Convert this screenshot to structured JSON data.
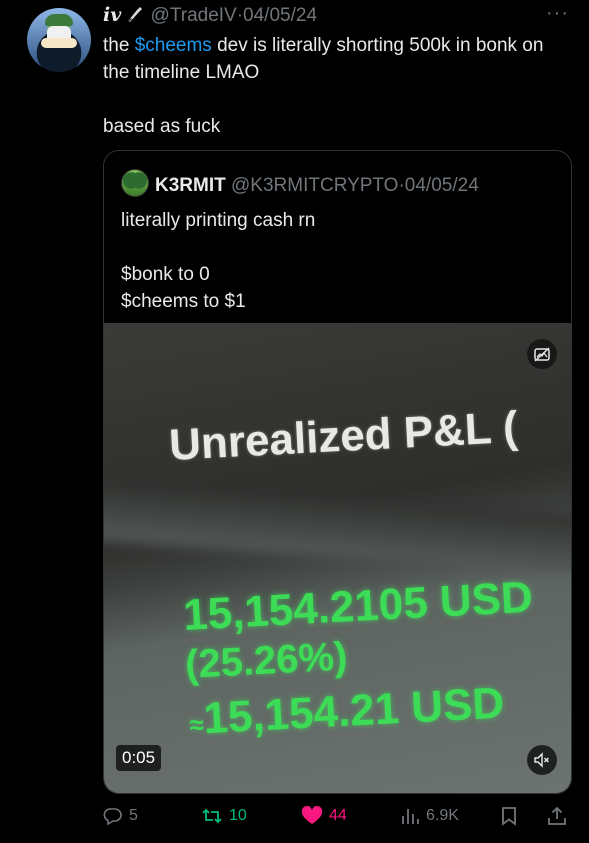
{
  "tweet": {
    "author_name": "iv",
    "handle": "@TradeIV",
    "separator": "·",
    "date": "04/05/24",
    "more": "···",
    "text_before": "the ",
    "mention": "$cheems",
    "text_after": " dev is literally shorting 500k in bonk on the timeline LMAO",
    "text_line2": "based as fuck"
  },
  "quote": {
    "author_name": "K3RMIT",
    "handle": "@K3RMITCRYPTO",
    "separator": "·",
    "date": "04/05/24",
    "line1": "literally printing cash rn",
    "line2": "$bonk to 0",
    "line3": "$cheems to $1",
    "media": {
      "label": "Unrealized P&L (",
      "value1": "15,154.2105 USD",
      "value2": "(25.26%)",
      "approx": "≈",
      "value3": "15,154.21 USD",
      "duration": "0:05"
    }
  },
  "actions": {
    "replies": "5",
    "retweets": "10",
    "likes": "44",
    "views": "6.9K"
  },
  "colors": {
    "background": "#000000",
    "text": "#e7e9ea",
    "muted": "#71767b",
    "mention": "#1d9bf0",
    "like": "#f91880",
    "pnl_green": "#3ddc57"
  }
}
